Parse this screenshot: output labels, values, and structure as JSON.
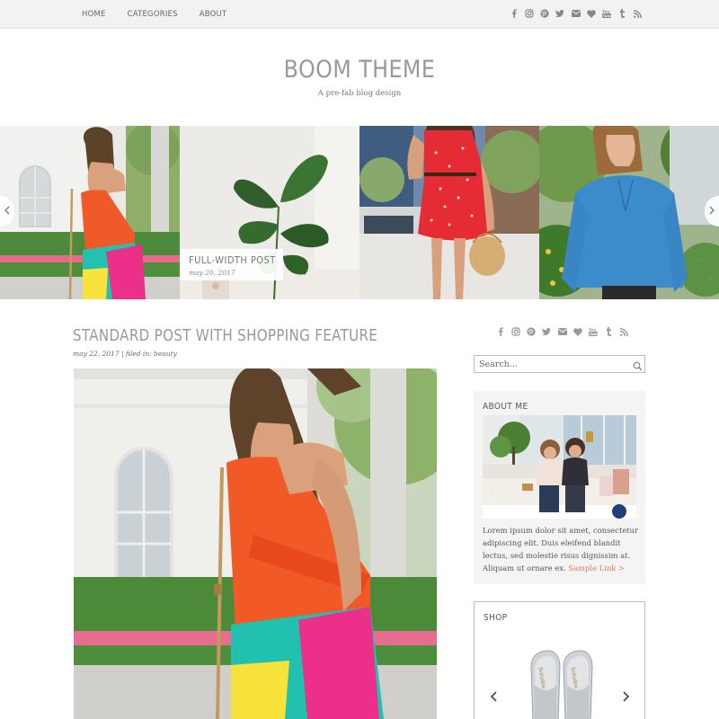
{
  "nav": {
    "items": [
      "HOME",
      "CATEGORIES",
      "ABOUT"
    ]
  },
  "social_icons": [
    "facebook-icon",
    "instagram-icon",
    "pinterest-icon",
    "twitter-icon",
    "email-icon",
    "heart-icon",
    "youtube-icon",
    "tumblr-icon",
    "rss-icon"
  ],
  "header": {
    "title": "BOOM THEME",
    "tagline": "A pre-fab blog design"
  },
  "slider": {
    "caption_title": "FULL-WIDTH POST",
    "caption_date": "may 20, 2017"
  },
  "post": {
    "title": "STANDARD POST WITH SHOPPING FEATURE",
    "meta": "may 22, 2017 | filed in: beauty"
  },
  "sidebar": {
    "search_placeholder": "Search...",
    "about": {
      "title": "ABOUT ME",
      "text": "Lorem ipsum dolor sit amet, consectetur adipiscing elit. Duis eleifend blandit lectus, sed molestie risus dignissim at. Aliquam ut ornare ex.",
      "link": "Sample Link >"
    },
    "shop": {
      "title": "SHOP"
    }
  },
  "colors": {
    "topbar": "#f2f2f2",
    "title_grey": "#999999",
    "link_accent": "#e07b5a",
    "about_bg": "#f4f4f4"
  }
}
